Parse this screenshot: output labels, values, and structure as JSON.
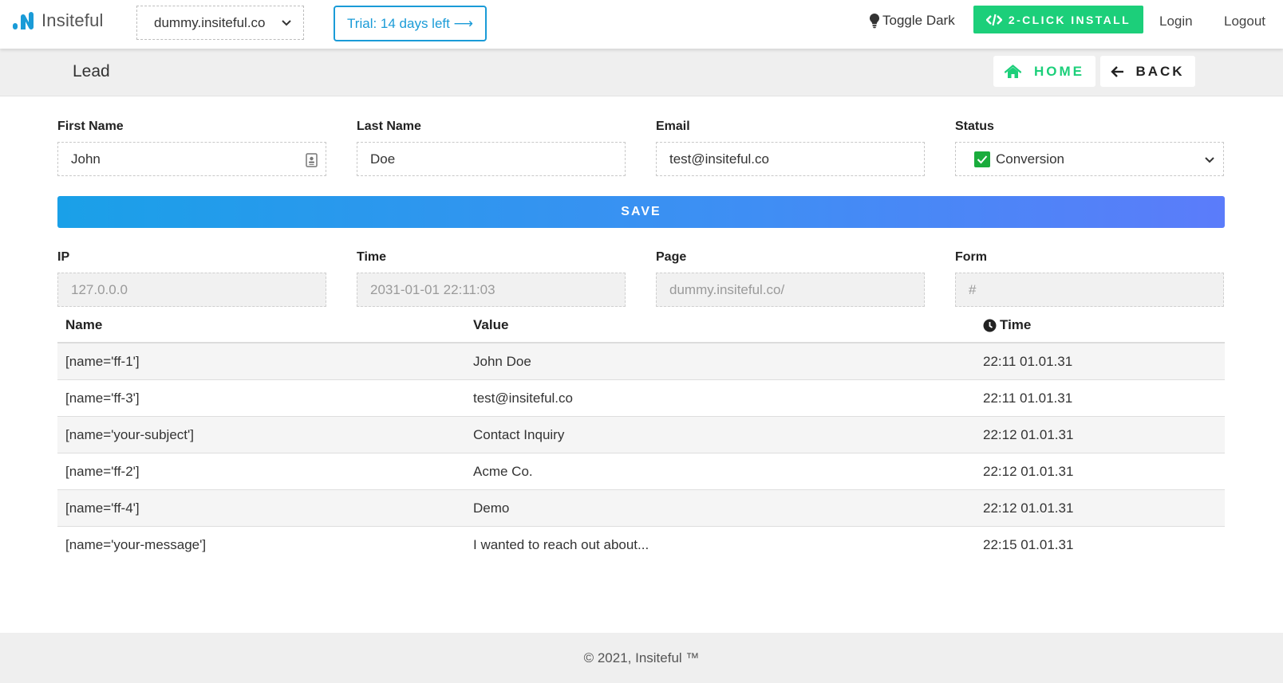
{
  "navbar": {
    "brand": "Insiteful",
    "site_select": "dummy.insiteful.co",
    "trial": "Trial: 14 days left ⟶",
    "toggle_dark": "Toggle Dark",
    "install": "2-CLICK INSTALL",
    "login": "Login",
    "logout": "Logout"
  },
  "subheader": {
    "title": "Lead",
    "home": "HOME",
    "back": "BACK"
  },
  "form": {
    "first_name": {
      "label": "First Name",
      "value": "John"
    },
    "last_name": {
      "label": "Last Name",
      "value": "Doe"
    },
    "email": {
      "label": "Email",
      "value": "test@insiteful.co"
    },
    "status": {
      "label": "Status",
      "value": "Conversion"
    },
    "save": "SAVE",
    "ip": {
      "label": "IP",
      "value": "127.0.0.0"
    },
    "time": {
      "label": "Time",
      "value": "2031-01-01 22:11:03"
    },
    "page": {
      "label": "Page",
      "value": "dummy.insiteful.co/"
    },
    "form": {
      "label": "Form",
      "value": "#"
    }
  },
  "table": {
    "headers": {
      "name": "Name",
      "value": "Value",
      "time": "Time"
    },
    "rows": [
      {
        "name": "[name='ff-1']",
        "value": "John Doe",
        "time": "22:11 01.01.31"
      },
      {
        "name": "[name='ff-3']",
        "value": "test@insiteful.co",
        "time": "22:11 01.01.31"
      },
      {
        "name": "[name='your-subject']",
        "value": "Contact Inquiry",
        "time": "22:12 01.01.31"
      },
      {
        "name": "[name='ff-2']",
        "value": "Acme Co.",
        "time": "22:12 01.01.31"
      },
      {
        "name": "[name='ff-4']",
        "value": "Demo",
        "time": "22:12 01.01.31"
      },
      {
        "name": "[name='your-message']",
        "value": "I wanted to reach out about...",
        "time": "22:15 01.01.31"
      }
    ]
  },
  "footer": "© 2021, Insiteful ™",
  "colors": {
    "brand_blue": "#1a9bd7",
    "install_green": "#1ccf7a",
    "status_green": "#1aac3c",
    "save_gradient_start": "#1aa0e8",
    "save_gradient_end": "#5b7cfa"
  },
  "icons": {
    "brand": "insiteful-logo-icon",
    "site_select": "chevron-down-icon",
    "toggle_dark": "lightbulb-icon",
    "install": "code-icon",
    "home": "home-icon",
    "back": "arrow-left-icon",
    "first_name": "contact-card-icon",
    "status": "check-square-icon",
    "time_header": "clock-icon"
  }
}
